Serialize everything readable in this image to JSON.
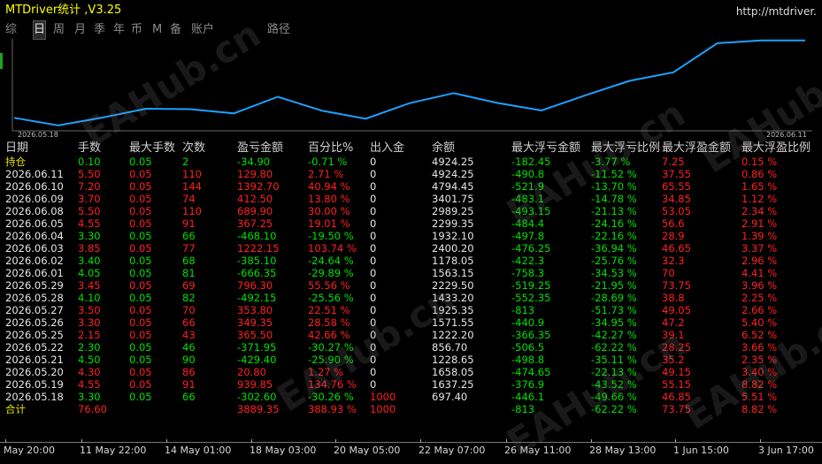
{
  "title": "MTDriver统计 ,V3.25",
  "url": "http://mtdriver.",
  "tabs": [
    "综",
    "日",
    "周",
    "月",
    "季",
    "年",
    "币",
    "M",
    "备",
    "账户",
    "路径"
  ],
  "active_tab": 1,
  "chart": {
    "start_label": "2026.05.18",
    "end_label": "2026.06.11",
    "line_color": "#1ea0ff",
    "balance": [
      1222.2,
      856.7,
      1228.65,
      1658.05,
      1637.25,
      1433.2,
      2229.5,
      1563.15,
      1178.05,
      1925.35,
      2400.2,
      1932.1,
      1571.55,
      2299.35,
      2989.25,
      3401.75,
      4794.45,
      4924.25,
      4924.25
    ]
  },
  "headers": [
    "日期",
    "手数",
    "最大手数",
    "次数",
    "盈亏金额",
    "百分比%",
    "出入金",
    "余额",
    "最大浮亏金额",
    "最大浮亏比例",
    "最大浮盈金额",
    "最大浮盈比例"
  ],
  "rows": [
    [
      "持仓",
      "0.10",
      "0.05",
      "2",
      "-34.90",
      "-0.71 %",
      "0",
      "4924.25",
      "-182.45",
      "-3.77 %",
      "7.25",
      "0.15 %"
    ],
    [
      "2026.06.11",
      "5.50",
      "0.05",
      "110",
      "129.80",
      "2.71 %",
      "0",
      "4924.25",
      "-490.8",
      "-11.52 %",
      "37.55",
      "0.86 %"
    ],
    [
      "2026.06.10",
      "7.20",
      "0.05",
      "144",
      "1392.70",
      "40.94 %",
      "0",
      "4794.45",
      "-521.9",
      "-13.70 %",
      "65.55",
      "1.65 %"
    ],
    [
      "2026.06.09",
      "3.70",
      "0.05",
      "74",
      "412.50",
      "13.80 %",
      "0",
      "3401.75",
      "-483.1",
      "-14.78 %",
      "34.85",
      "1.12 %"
    ],
    [
      "2026.06.08",
      "5.50",
      "0.05",
      "110",
      "689.90",
      "30.00 %",
      "0",
      "2989.25",
      "-493.15",
      "-21.13 %",
      "53.05",
      "2.34 %"
    ],
    [
      "2026.06.05",
      "4.55",
      "0.05",
      "91",
      "367.25",
      "19.01 %",
      "0",
      "2299.35",
      "-484.4",
      "-24.16 %",
      "56.6",
      "2.91 %"
    ],
    [
      "2026.06.04",
      "3.30",
      "0.05",
      "66",
      "-468.10",
      "-19.50 %",
      "0",
      "1932.10",
      "-497.8",
      "-22.16 %",
      "28.9",
      "1.39 %"
    ],
    [
      "2026.06.03",
      "3.85",
      "0.05",
      "77",
      "1222.15",
      "103.74 %",
      "0",
      "2400.20",
      "-476.25",
      "-36.94 %",
      "46.65",
      "3.37 %"
    ],
    [
      "2026.06.02",
      "3.40",
      "0.05",
      "68",
      "-385.10",
      "-24.64 %",
      "0",
      "1178.05",
      "-422.3",
      "-25.76 %",
      "32.3",
      "2.96 %"
    ],
    [
      "2026.06.01",
      "4.05",
      "0.05",
      "81",
      "-666.35",
      "-29.89 %",
      "0",
      "1563.15",
      "-758.3",
      "-34.53 %",
      "70",
      "4.41 %"
    ],
    [
      "2026.05.29",
      "3.45",
      "0.05",
      "69",
      "796.30",
      "55.56 %",
      "0",
      "2229.50",
      "-519.25",
      "-21.95 %",
      "73.75",
      "3.96 %"
    ],
    [
      "2026.05.28",
      "4.10",
      "0.05",
      "82",
      "-492.15",
      "-25.56 %",
      "0",
      "1433.20",
      "-552.35",
      "-28.69 %",
      "38.8",
      "2.25 %"
    ],
    [
      "2026.05.27",
      "3.50",
      "0.05",
      "70",
      "353.80",
      "22.51 %",
      "0",
      "1925.35",
      "-813",
      "-51.73 %",
      "49.05",
      "2.66 %"
    ],
    [
      "2026.05.26",
      "3.30",
      "0.05",
      "66",
      "349.35",
      "28.58 %",
      "0",
      "1571.55",
      "-440.9",
      "-34.95 %",
      "47.2",
      "5.40 %"
    ],
    [
      "2026.05.25",
      "2.15",
      "0.05",
      "43",
      "365.50",
      "42.66 %",
      "0",
      "1222.20",
      "-366.35",
      "-42.27 %",
      "39.1",
      "6.52 %"
    ],
    [
      "2026.05.22",
      "2.30",
      "0.05",
      "46",
      "-371.95",
      "-30.27 %",
      "0",
      "856.70",
      "-506.5",
      "-62.22 %",
      "28.25",
      "3.66 %"
    ],
    [
      "2026.05.21",
      "4.50",
      "0.05",
      "90",
      "-429.40",
      "-25.90 %",
      "0",
      "1228.65",
      "-498.8",
      "-35.11 %",
      "35.2",
      "2.35 %"
    ],
    [
      "2026.05.20",
      "4.30",
      "0.05",
      "86",
      "20.80",
      "1.27 %",
      "0",
      "1658.05",
      "-474.65",
      "-22.13 %",
      "49.15",
      "3.40 %"
    ],
    [
      "2026.05.19",
      "4.55",
      "0.05",
      "91",
      "939.85",
      "134.76 %",
      "0",
      "1637.25",
      "-376.9",
      "-43.52 %",
      "55.15",
      "8.82 %"
    ],
    [
      "2026.05.18",
      "3.30",
      "0.05",
      "66",
      "-302.60",
      "-30.26 %",
      "1000",
      "697.40",
      "-446.1",
      "-49.66 %",
      "46.85",
      "5.51 %"
    ],
    [
      "合计",
      "76.60",
      "",
      "",
      "3889.35",
      "388.93 %",
      "1000",
      "",
      "-813",
      "-62.22 %",
      "73.75",
      "8.82 %"
    ]
  ],
  "xaxis": [
    "May 20:00",
    "11 May 22:00",
    "14 May 01:00",
    "18 May 03:00",
    "20 May 05:00",
    "22 May 07:00",
    "26 May 11:00",
    "28 May 13:00",
    "1 Jun 15:00",
    "3 Jun 17:00"
  ],
  "watermark": "EAHub.cn",
  "colors": {
    "positive": "#00e000",
    "negative": "#ff2020",
    "text": "#e6e6e6",
    "title": "#ffff00"
  }
}
